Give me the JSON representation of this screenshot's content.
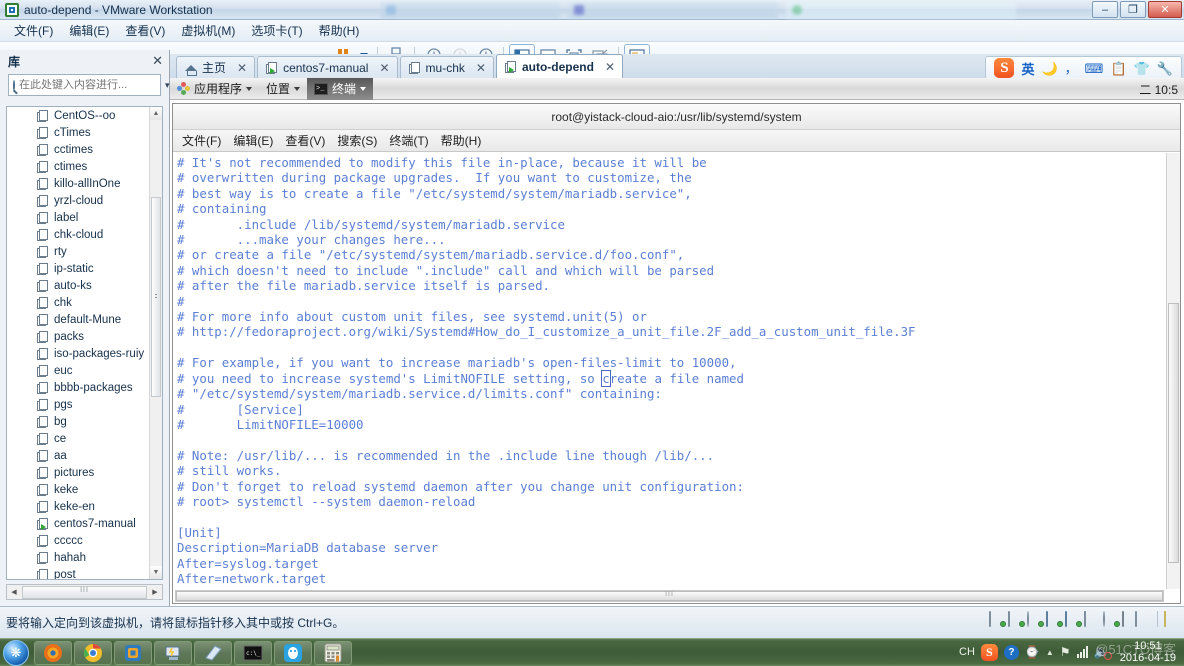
{
  "window": {
    "title": "auto-depend - VMware Workstation",
    "app_icon": "vmware-icon",
    "minimize": "–",
    "maximize": "❐",
    "close": "✕",
    "background_windows": [
      "",
      "",
      ""
    ]
  },
  "menubar": {
    "items": [
      {
        "label": "文件(F)",
        "name": "menu-file"
      },
      {
        "label": "编辑(E)",
        "name": "menu-edit"
      },
      {
        "label": "查看(V)",
        "name": "menu-view"
      },
      {
        "label": "虚拟机(M)",
        "name": "menu-vm"
      },
      {
        "label": "选项卡(T)",
        "name": "menu-tabs"
      },
      {
        "label": "帮助(H)",
        "name": "menu-help"
      }
    ]
  },
  "toolbar": {
    "buttons": [
      "pause-button",
      "power-dropdown-caret",
      "snapshot-manager-icon",
      "take-snapshot-icon",
      "revert-snapshot-icon",
      "manage-snapshots-icon",
      "show-library-icon",
      "show-thumbnail-bar-icon",
      "fullscreen-icon",
      "unity-mode-icon",
      "console-view-icon"
    ]
  },
  "library": {
    "title": "库",
    "close_label": "✕",
    "search_placeholder": "在此处键入内容进行...",
    "search_value": "",
    "dropdown_caret": "▾",
    "items": [
      {
        "label": "CentOS--oo",
        "running": false
      },
      {
        "label": "cTimes",
        "running": false
      },
      {
        "label": "cctimes",
        "running": false
      },
      {
        "label": "ctimes",
        "running": false
      },
      {
        "label": "killo-allInOne",
        "running": false
      },
      {
        "label": "yrzl-cloud",
        "running": false
      },
      {
        "label": "label",
        "running": false
      },
      {
        "label": "chk-cloud",
        "running": false
      },
      {
        "label": "rty",
        "running": false
      },
      {
        "label": "ip-static",
        "running": false
      },
      {
        "label": "auto-ks",
        "running": false
      },
      {
        "label": "chk",
        "running": false
      },
      {
        "label": "default-Mune",
        "running": false
      },
      {
        "label": "packs",
        "running": false
      },
      {
        "label": "iso-packages-ruiy",
        "running": false
      },
      {
        "label": "euc",
        "running": false
      },
      {
        "label": "bbbb-packages",
        "running": false
      },
      {
        "label": "pgs",
        "running": false
      },
      {
        "label": "bg",
        "running": false
      },
      {
        "label": "ce",
        "running": false
      },
      {
        "label": "aa",
        "running": false
      },
      {
        "label": "pictures",
        "running": false
      },
      {
        "label": "keke",
        "running": false
      },
      {
        "label": "keke-en",
        "running": false
      },
      {
        "label": "centos7-manual",
        "running": true
      },
      {
        "label": "ccccc",
        "running": false
      },
      {
        "label": "hahah",
        "running": false
      },
      {
        "label": "post",
        "running": false
      }
    ]
  },
  "tabs": [
    {
      "label": "主页",
      "icon": "home-icon",
      "active": false,
      "close": "✕"
    },
    {
      "label": "centos7-manual",
      "icon": "vm-icon",
      "active": false,
      "close": "✕"
    },
    {
      "label": "mu-chk",
      "icon": "vm-icon",
      "active": false,
      "close": "✕"
    },
    {
      "label": "auto-depend",
      "icon": "vm-icon",
      "active": true,
      "close": "✕"
    }
  ],
  "ime": {
    "logo": "S",
    "mode": "英",
    "icons": [
      "moon-icon",
      "comma-icon",
      "soft-keyboard-icon",
      "clipboard-icon",
      "skin-icon",
      "wrench-icon"
    ]
  },
  "gnome_panel": {
    "applications": "应用程序",
    "places": "位置",
    "window_button": "终端",
    "caret": "▾",
    "right_text": "二 10:5"
  },
  "terminal": {
    "title": "root@yistack-cloud-aio:/usr/lib/systemd/system",
    "menu": [
      "文件(F)",
      "编辑(E)",
      "查看(V)",
      "搜索(S)",
      "终端(T)",
      "帮助(H)"
    ],
    "text_color": "#5b7fd4",
    "lines_before_cursor": [
      "# It's not recommended to modify this file in-place, because it will be",
      "# overwritten during package upgrades.  If you want to customize, the",
      "# best way is to create a file \"/etc/systemd/system/mariadb.service\",",
      "# containing",
      "#       .include /lib/systemd/system/mariadb.service",
      "#       ...make your changes here...",
      "# or create a file \"/etc/systemd/system/mariadb.service.d/foo.conf\",",
      "# which doesn't need to include \".include\" call and which will be parsed",
      "# after the file mariadb.service itself is parsed.",
      "#",
      "# For more info about custom unit files, see systemd.unit(5) or",
      "# http://fedoraproject.org/wiki/Systemd#How_do_I_customize_a_unit_file.2F_add_a_custom_unit_file.3F",
      "",
      "# For example, if you want to increase mariadb's open-files-limit to 10000,"
    ],
    "cursor_line": {
      "prefix": "# you need to increase systemd's LimitNOFILE setting, so ",
      "cursor_char": "c",
      "suffix": "reate a file named"
    },
    "lines_after_cursor": [
      "# \"/etc/systemd/system/mariadb.service.d/limits.conf\" containing:",
      "#       [Service]",
      "#       LimitNOFILE=10000",
      "",
      "# Note: /usr/lib/... is recommended in the .include line though /lib/...",
      "# still works.",
      "# Don't forget to reload systemd daemon after you change unit configuration:",
      "# root> systemctl --system daemon-reload",
      "",
      "[Unit]",
      "Description=MariaDB database server",
      "After=syslog.target",
      "After=network.target"
    ]
  },
  "statusbar": {
    "message": "要将输入定向到该虚拟机，请将鼠标指针移入其中或按 Ctrl+G。",
    "devices": [
      "hard-disk-icon",
      "hard-disk-2-icon",
      "cd-dvd-icon",
      "network-adapter-icon",
      "network-adapter-2-icon",
      "printer-icon",
      "sound-card-icon",
      "usb-device-icon",
      "display-icon",
      "notes-icon"
    ]
  },
  "taskbar": {
    "start": "start-orb",
    "buttons": [
      "firefox-icon",
      "chrome-icon",
      "vmware-workstation-icon",
      "remote-desktop-icon",
      "notepad-icon",
      "command-prompt-icon",
      "qq-icon",
      "calculator-icon"
    ],
    "tray": {
      "ime_indicator": "CH",
      "sogou": "S",
      "help": "?",
      "network": "network-icon",
      "show_hidden": "▲",
      "action_center": "action-center-icon",
      "signal": "signal-icon",
      "volume": "volume-muted-icon",
      "time": "10:51",
      "date": "2016-04-19"
    },
    "watermark": "@51CTO博客"
  }
}
